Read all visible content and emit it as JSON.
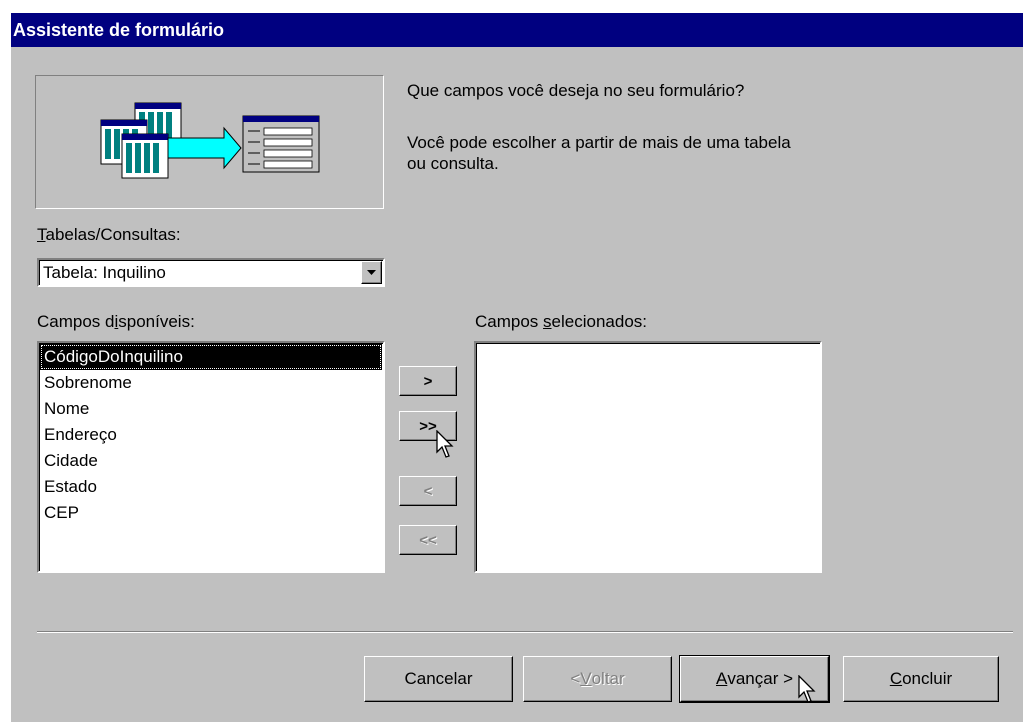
{
  "window": {
    "title": "Assistente de formulário"
  },
  "intro": {
    "question": "Que campos você deseja no seu formulário?",
    "hint_line1": "Você pode escolher a partir de mais de uma tabela",
    "hint_line2": "ou consulta."
  },
  "tables": {
    "label_key": "T",
    "label_rest": "abelas/Consultas:",
    "selected": "Tabela: Inquilino"
  },
  "available": {
    "label_pre": "Campos d",
    "label_key": "i",
    "label_post": "sponíveis:",
    "items": [
      "CódigoDoInquilino",
      "Sobrenome",
      "Nome",
      "Endereço",
      "Cidade",
      "Estado",
      "CEP"
    ]
  },
  "selected_fields": {
    "label_pre": "Campos ",
    "label_key": "s",
    "label_post": "elecionados:",
    "items": []
  },
  "transfer": {
    "add_one": ">",
    "add_all": ">>",
    "remove_one": "<",
    "remove_all": "<<"
  },
  "footer": {
    "cancel": "Cancelar",
    "back_pre": "< ",
    "back_key": "V",
    "back_post": "oltar",
    "next_key": "A",
    "next_post": "vançar >",
    "finish_key": "C",
    "finish_post": "oncluir"
  },
  "colors": {
    "titlebar": "#000080",
    "face": "#c0c0c0",
    "selection": "#000000",
    "arrow_accent": "#00ffff"
  },
  "icons": [
    "tables-to-form-illustration",
    "combo-arrow-icon",
    "mouse-cursor-icon"
  ]
}
